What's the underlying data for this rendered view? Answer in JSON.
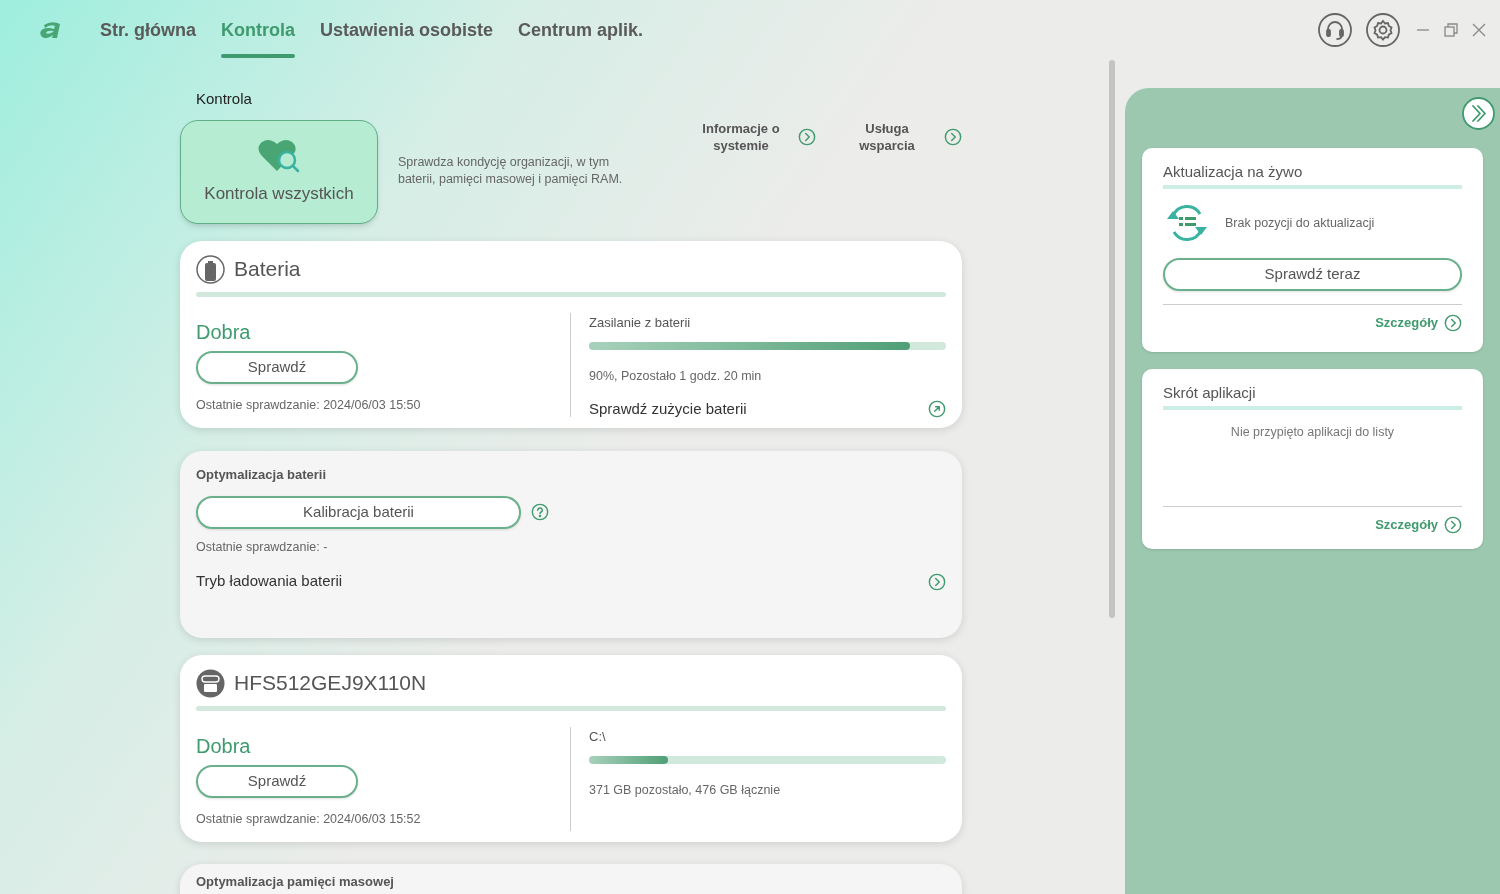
{
  "tabs": [
    {
      "label": "Str. główna",
      "selected": false
    },
    {
      "label": "Kontrola",
      "selected": true
    },
    {
      "label": "Ustawienia osobiste",
      "selected": false
    },
    {
      "label": "Centrum aplik.",
      "selected": false
    }
  ],
  "section_title": "Kontrola",
  "check_all": {
    "label": "Kontrola wszystkich",
    "description": "Sprawdza kondycję organizacji, w tym baterii, pamięci masowej i pamięci RAM."
  },
  "links": [
    {
      "label": "Informacje o systemie"
    },
    {
      "label": "Usługa wsparcia"
    }
  ],
  "battery": {
    "title": "Bateria",
    "status": "Dobra",
    "button": "Sprawdź",
    "last_check": "Ostatnie sprawdzanie: 2024/06/03 15:50",
    "meter_label": "Zasilanie z baterii",
    "level": 0.9,
    "reading": "90%, Pozostało 1 godz. 20 min",
    "link": "Sprawdź zużycie baterii"
  },
  "optimization": {
    "title": "Optymalizacja baterii",
    "button": "Kalibracja baterii",
    "last_check": "Ostatnie sprawdzanie: -",
    "link": "Tryb ładowania baterii"
  },
  "disk": {
    "title": "HFS512GEJ9X110N",
    "status": "Dobra",
    "button": "Sprawdź",
    "last_check": "Ostatnie sprawdzanie: 2024/06/03 15:52",
    "meter_label": "C:\\",
    "level": 0.22,
    "reading": "371 GB pozostało, 476 GB łącznie"
  },
  "next_card_title": "Optymalizacja pamięci masowej",
  "live_update": {
    "title": "Aktualizacja na żywo",
    "message": "Brak pozycji do aktualizacji",
    "button": "Sprawdź teraz",
    "details": "Szczegóły"
  },
  "shortcuts": {
    "title": "Skrót aplikacji",
    "message": "Nie przypięto aplikacji do listy",
    "details": "Szczegóły"
  }
}
